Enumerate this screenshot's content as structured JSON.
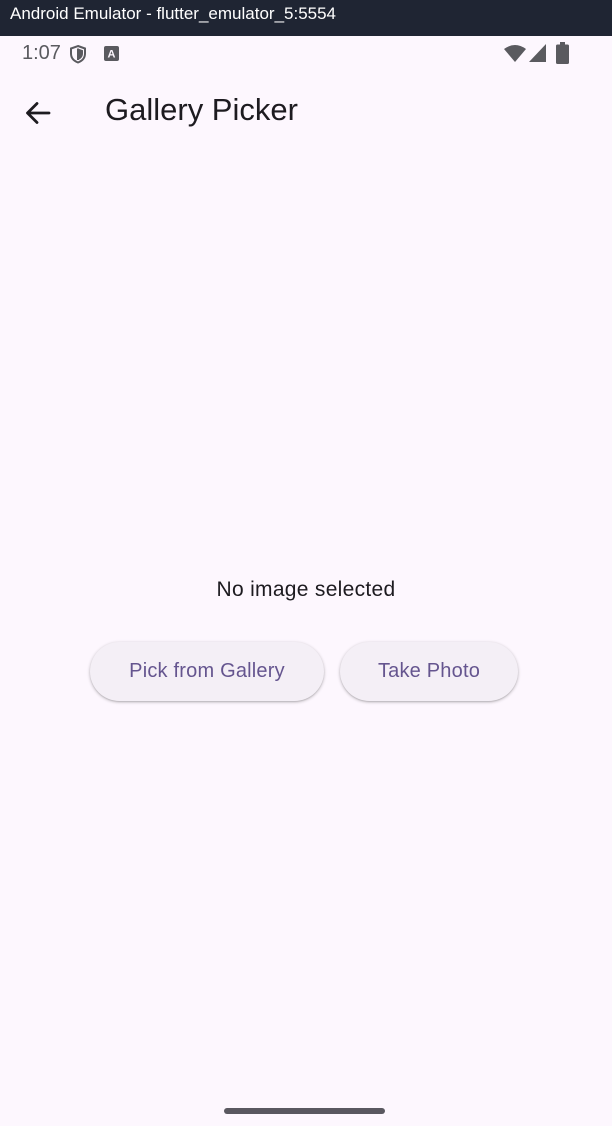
{
  "window": {
    "title": "Android Emulator - flutter_emulator_5:5554"
  },
  "status_bar": {
    "time": "1:07",
    "left_icons": [
      "shield-icon",
      "a-badge-icon"
    ],
    "right_icons": [
      "wifi-icon",
      "signal-icon",
      "battery-icon"
    ]
  },
  "app_bar": {
    "back_icon": "arrow-back-icon",
    "title": "Gallery Picker"
  },
  "content": {
    "empty_message": "No image selected",
    "buttons": {
      "gallery_label": "Pick from Gallery",
      "photo_label": "Take Photo"
    }
  },
  "colors": {
    "background": "#fdf7fe",
    "button_background": "#f4eff6",
    "button_text": "#65558f",
    "title_text": "#1d1b20",
    "titlebar": "#1f2533"
  }
}
